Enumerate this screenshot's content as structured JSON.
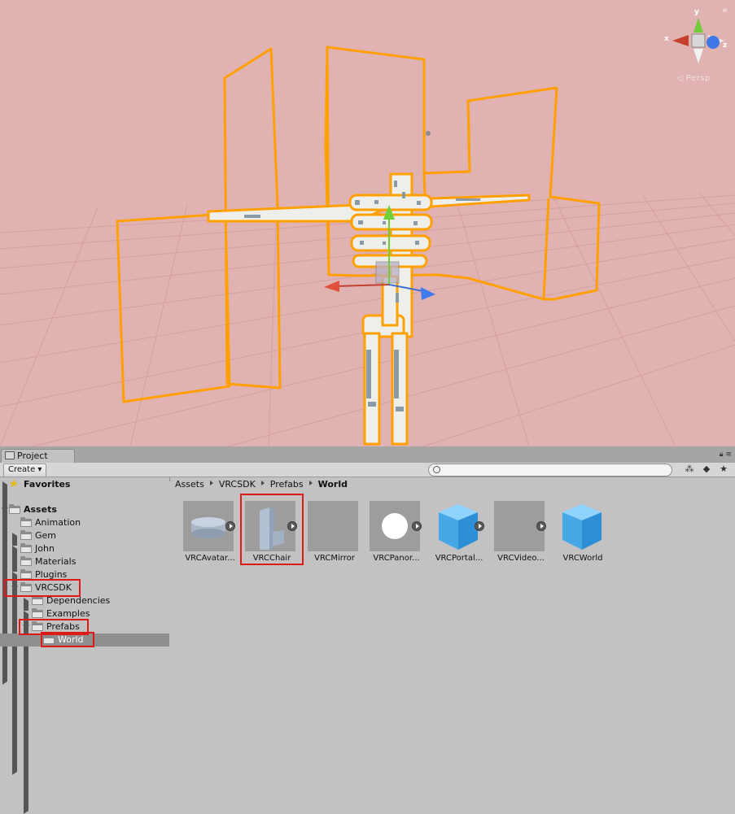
{
  "scene": {
    "background_color": "#e1b2b2",
    "selection_color": "#ffa000",
    "gizmo": {
      "x_label": "x",
      "y_label": "y",
      "z_label": "z"
    },
    "persp_label": "◁ Persp",
    "gizmo_menu_icon": "menu-icon"
  },
  "project": {
    "tab_label": "Project",
    "create_label": "Create ▾",
    "search_placeholder": "",
    "toolbar_icons": [
      "filter-by-type-icon",
      "filter-by-label-icon",
      "favorite-star-icon"
    ],
    "tree": {
      "favorites_label": "Favorites",
      "assets_label": "Assets",
      "animation_label": "Animation",
      "gem_label": "Gem",
      "john_label": "John",
      "materials_label": "Materials",
      "plugins_label": "Plugins",
      "vrcsdk_label": "VRCSDK",
      "dependencies_label": "Dependencies",
      "examples_label": "Examples",
      "prefabs_label": "Prefabs",
      "world_label": "World"
    },
    "breadcrumb": [
      "Assets",
      "VRCSDK",
      "Prefabs",
      "World"
    ],
    "assets": [
      {
        "label": "VRCAvatar...",
        "icon": "cylinder-prefab-icon"
      },
      {
        "label": "VRCChair",
        "icon": "chair-prefab-icon"
      },
      {
        "label": "VRCMirror",
        "icon": "mirror-prefab-icon"
      },
      {
        "label": "VRCPanor...",
        "icon": "white-sphere-prefab-icon"
      },
      {
        "label": "VRCPortal...",
        "icon": "blue-cube-prefab-icon"
      },
      {
        "label": "VRCVideo...",
        "icon": "video-prefab-icon"
      },
      {
        "label": "VRCWorld",
        "icon": "blue-cube-prefab-icon"
      }
    ],
    "highlight_color": "#e01818"
  }
}
